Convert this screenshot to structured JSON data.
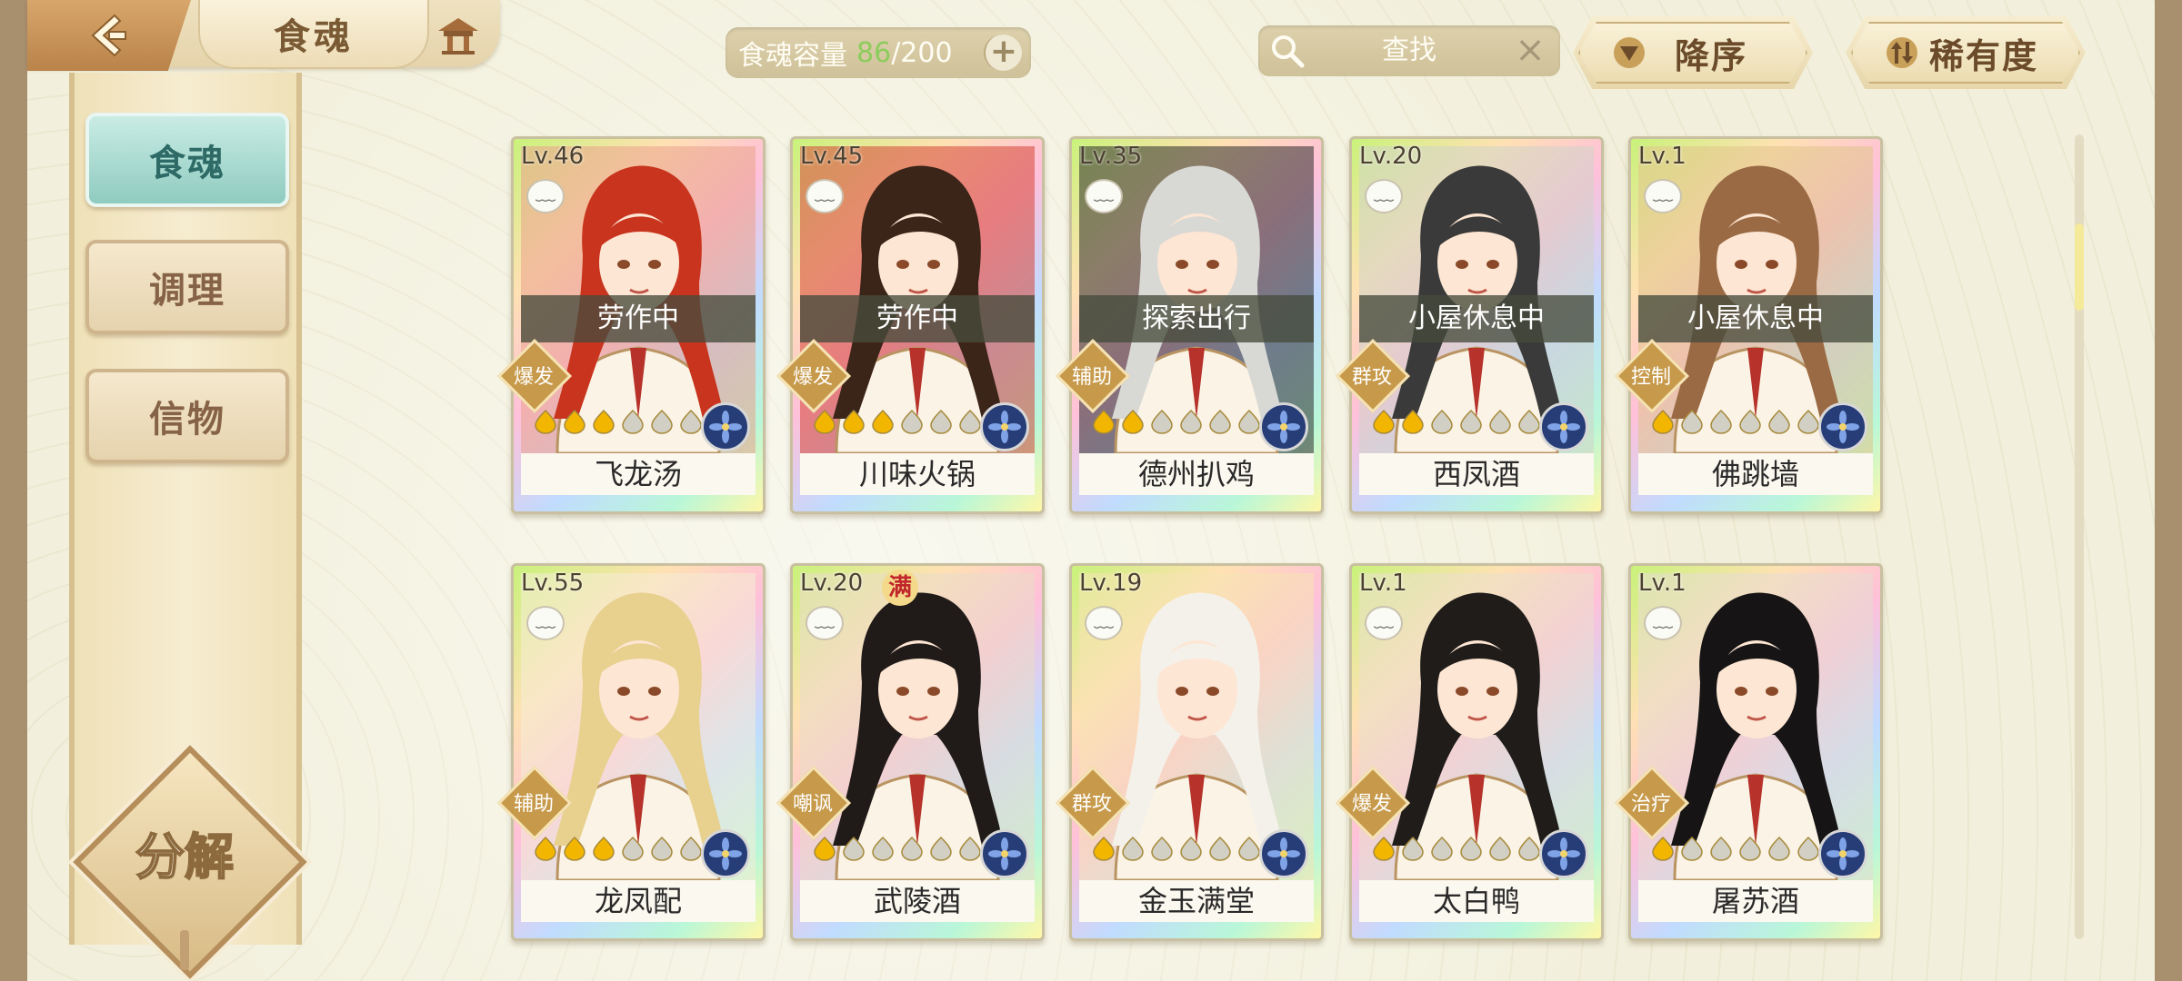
{
  "header": {
    "title": "食魂",
    "capacity_label": "食魂容量",
    "capacity_current": "86",
    "capacity_sep": "/",
    "capacity_max": "200",
    "capacity_add": "+",
    "search_text": "查找",
    "search_clear": "×",
    "sort_order": "降序",
    "sort_key": "稀有度"
  },
  "sidebar": {
    "items": [
      {
        "label": "食魂",
        "active": true
      },
      {
        "label": "调理",
        "active": false
      },
      {
        "label": "信物",
        "active": false
      }
    ],
    "decompose_label": "分解"
  },
  "cards": [
    {
      "level": "Lv.46",
      "status": "劳作中",
      "role": "爆发",
      "stars_filled": 3,
      "name": "飞龙汤",
      "hair": "#c8341e",
      "bg": "#e9a28c"
    },
    {
      "level": "Lv.45",
      "status": "劳作中",
      "role": "爆发",
      "stars_filled": 3,
      "name": "川味火锅",
      "hair": "#3b2418",
      "bg": "#d44536"
    },
    {
      "level": "Lv.35",
      "status": "探索出行",
      "role": "辅助",
      "stars_filled": 2,
      "name": "德州扒鸡",
      "hair": "#d8d8d4",
      "bg": "#2b2b2b"
    },
    {
      "level": "Lv.20",
      "status": "小屋休息中",
      "role": "群攻",
      "stars_filled": 2,
      "name": "西凤酒",
      "hair": "#3a3a3a",
      "bg": "#cfd3c8"
    },
    {
      "level": "Lv.1",
      "status": "小屋休息中",
      "role": "控制",
      "stars_filled": 1,
      "name": "佛跳墙",
      "hair": "#9a6a44",
      "bg": "#e0c58a"
    },
    {
      "level": "Lv.55",
      "status": "",
      "role": "辅助",
      "stars_filled": 3,
      "name": "龙凤配",
      "hair": "#e8d08e",
      "bg": "#f4ecd6"
    },
    {
      "level": "Lv.20",
      "status": "",
      "role": "嘲讽",
      "stars_filled": 1,
      "name": "武陵酒",
      "hair": "#201a18",
      "bg": "#e9dcc8",
      "full": "满"
    },
    {
      "level": "Lv.19",
      "status": "",
      "role": "群攻",
      "stars_filled": 1,
      "name": "金玉满堂",
      "hair": "#f4f1ea",
      "bg": "#f5e3b2"
    },
    {
      "level": "Lv.1",
      "status": "",
      "role": "爆发",
      "stars_filled": 1,
      "name": "太白鸭",
      "hair": "#1f1c1a",
      "bg": "#e9e0cc"
    },
    {
      "level": "Lv.1",
      "status": "",
      "role": "治疗",
      "stars_filled": 1,
      "name": "屠苏酒",
      "hair": "#161414",
      "bg": "#e6ddd1"
    }
  ],
  "colors": {
    "accent_teal": "#8fcbc0",
    "brown_text": "#6b4b2a",
    "capacity_green": "#8ccc5c",
    "element_blue": "#273d78",
    "star_gold": "#f2b600",
    "star_empty": "#d2cfc4"
  },
  "icons": {
    "back": "back-arrow-icon",
    "home": "pavilion-icon",
    "search": "magnifier-icon",
    "sort_order": "triangle-down-icon",
    "sort_key": "sort-arrows-icon",
    "element": "blue-flower-icon",
    "mood": "face-icon"
  }
}
